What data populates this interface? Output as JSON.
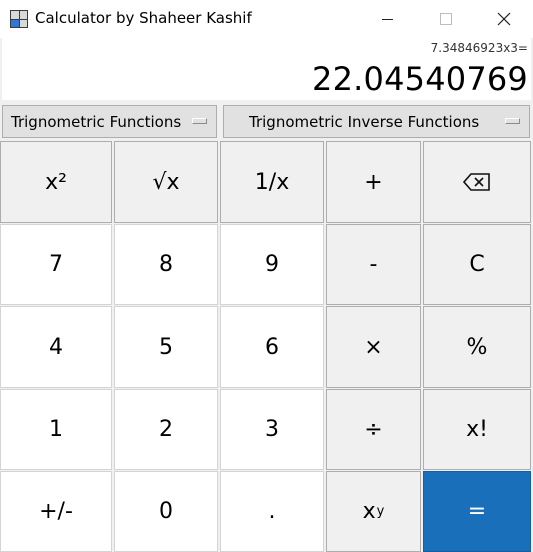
{
  "window": {
    "title": "Calculator by Shaheer Kashif",
    "icon": "calculator-icon"
  },
  "display": {
    "expression": "7.34846923x3=",
    "result": "22.04540769"
  },
  "dropdowns": {
    "trig": "Trignometric Functions",
    "trig_inverse": "Trignometric Inverse Functions"
  },
  "keys": {
    "square": "x²",
    "sqrt": "√x",
    "reciprocal": "1/x",
    "plus": "+",
    "backspace": "⌫",
    "seven": "7",
    "eight": "8",
    "nine": "9",
    "minus": "-",
    "clear": "C",
    "four": "4",
    "five": "5",
    "six": "6",
    "multiply": "×",
    "percent": "%",
    "one": "1",
    "two": "2",
    "three": "3",
    "divide": "÷",
    "factorial": "x!",
    "negate": "+/-",
    "zero": "0",
    "decimal": ".",
    "power_base": "x",
    "power_exp": "y",
    "equals": "="
  },
  "colors": {
    "equals_bg": "#1a6fba",
    "background": "#f0f0f0"
  }
}
